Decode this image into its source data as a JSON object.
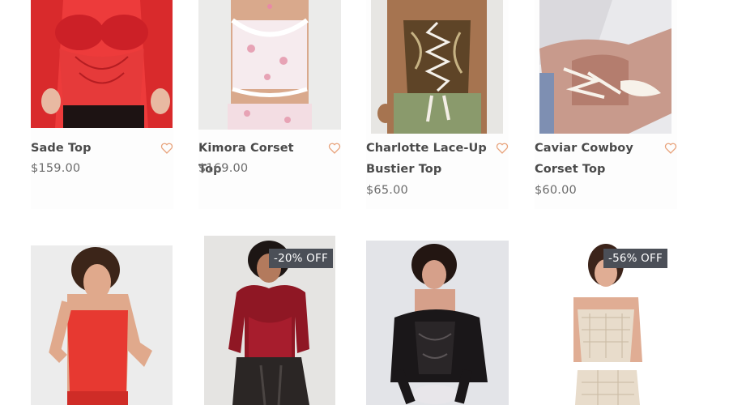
{
  "products": [
    {
      "name": "Sade Top",
      "price": "$159.00"
    },
    {
      "name": "Kimora Corset Top",
      "price": "$169.00"
    },
    {
      "name": "Charlotte Lace-Up Bustier Top",
      "price": "$65.00"
    },
    {
      "name": "Caviar Cowboy Corset Top",
      "price": "$60.00"
    }
  ],
  "row2": [
    {
      "badge": ""
    },
    {
      "badge": "-20% OFF"
    },
    {
      "badge": ""
    },
    {
      "badge": "-56% OFF"
    }
  ],
  "icons": {
    "wishlist": "heart-outline-icon"
  },
  "colors": {
    "heart": "#e8a27a",
    "badge_bg": "#4b4f57"
  }
}
